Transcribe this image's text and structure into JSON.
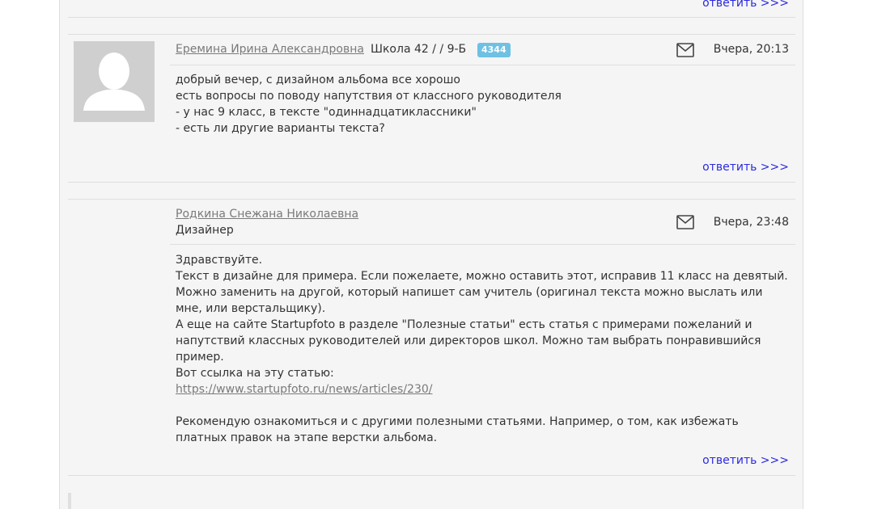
{
  "reply_label": "ответить >>>",
  "comments": [
    {
      "author": "Еремина Ирина Александровна",
      "school": "Школа 42 / / 9-Б",
      "badge": "4344",
      "date": "Вчера, 20:13",
      "lines": [
        "добрый вечер, с дизайном альбома все хорошо",
        "есть вопросы по поводу напутствия от классного руководителя",
        "- у нас 9 класс, в тексте \"одиннадцатиклассники\"",
        "- есть ли другие варианты текста?"
      ]
    },
    {
      "author": "Родкина Снежана Николаевна",
      "role": "Дизайнер",
      "date": "Вчера, 23:48",
      "lines": [
        "Здравствуйте.",
        "Текст в дизайне для примера. Если пожелаете, можно оставить этот, исправив 11 класс на девятый.",
        "Можно заменить на другой, который напишет сам учитель (оригинал текста можно выслать или мне, или верстальщику).",
        "А еще на сайте Startupfoto в разделе \"Полезные статьи\" есть статья с примерами пожеланий и напутствий классных руководителей или директоров школ. Можно там выбрать понравившийся пример.",
        "Вот ссылка на эту статью:"
      ],
      "link": "https://www.startupfoto.ru/news/articles/230/",
      "after_link": "Рекомендую ознакомиться и с другими полезными статьями. Например, о том, как избежать платных правок на этапе верстки альбома."
    }
  ],
  "colors": {
    "link_blue": "#2a2ae0",
    "badge_bg": "#6ec1e4",
    "panel_bg": "#f5f5f5"
  }
}
